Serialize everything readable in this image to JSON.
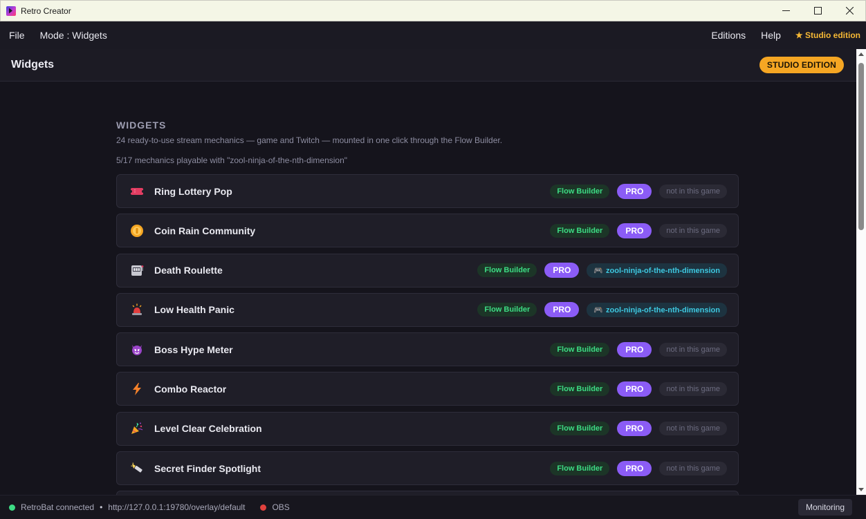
{
  "window": {
    "title": "Retro Creator"
  },
  "menu": {
    "file": "File",
    "mode": "Mode : Widgets",
    "editions": "Editions",
    "help": "Help",
    "studio": "★ Studio edition"
  },
  "header": {
    "title": "Widgets",
    "badge": "STUDIO EDITION"
  },
  "section": {
    "title": "WIDGETS",
    "description": "24 ready-to-use stream mechanics — game and Twitch — mounted in one click through the Flow Builder.",
    "count": "5/17 mechanics playable with \"zool-ninja-of-the-nth-dimension\""
  },
  "widgets": [
    {
      "name": "Ring Lottery Pop",
      "icon": "ticket-icon",
      "flow": "Flow Builder",
      "pro": "PRO",
      "status": "not in this game",
      "in_game": false
    },
    {
      "name": "Coin Rain Community",
      "icon": "coin-icon",
      "flow": "Flow Builder",
      "pro": "PRO",
      "status": "not in this game",
      "in_game": false
    },
    {
      "name": "Death Roulette",
      "icon": "slot-machine-icon",
      "flow": "Flow Builder",
      "pro": "PRO",
      "status": "zool-ninja-of-the-nth-dimension",
      "in_game": true
    },
    {
      "name": "Low Health Panic",
      "icon": "siren-icon",
      "flow": "Flow Builder",
      "pro": "PRO",
      "status": "zool-ninja-of-the-nth-dimension",
      "in_game": true
    },
    {
      "name": "Boss Hype Meter",
      "icon": "devil-icon",
      "flow": "Flow Builder",
      "pro": "PRO",
      "status": "not in this game",
      "in_game": false
    },
    {
      "name": "Combo Reactor",
      "icon": "lightning-icon",
      "flow": "Flow Builder",
      "pro": "PRO",
      "status": "not in this game",
      "in_game": false
    },
    {
      "name": "Level Clear Celebration",
      "icon": "party-popper-icon",
      "flow": "Flow Builder",
      "pro": "PRO",
      "status": "not in this game",
      "in_game": false
    },
    {
      "name": "Secret Finder Spotlight",
      "icon": "flashlight-icon",
      "flow": "Flow Builder",
      "pro": "PRO",
      "status": "not in this game",
      "in_game": false
    }
  ],
  "statusbar": {
    "retrobat": "RetroBat connected",
    "separator": "•",
    "url": "http://127.0.0.1:19780/overlay/default",
    "obs": "OBS",
    "monitoring": "Monitoring"
  },
  "colors": {
    "accent": "#8b5cf6",
    "studio": "#f5a623",
    "connected": "#3ddc84",
    "disconnected": "#e0413d"
  }
}
